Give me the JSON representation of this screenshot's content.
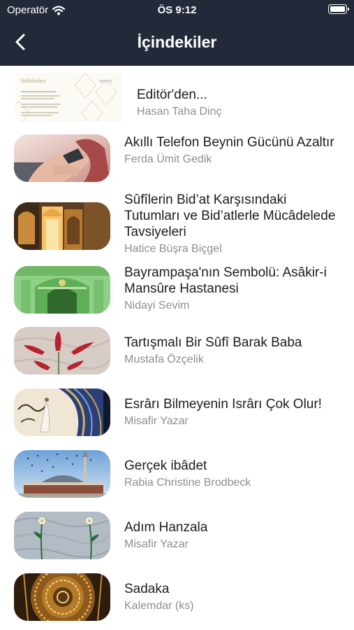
{
  "status": {
    "carrier": "Operatör",
    "time": "ÖS 9:12"
  },
  "nav": {
    "title": "İçindekiler",
    "back_icon": "chevron-left-icon"
  },
  "articles": [
    {
      "title": "Editör'den...",
      "author": "Hasan Taha Dinç",
      "thumbnail": "editorial-page-thumbnail"
    },
    {
      "title": "Akıllı Telefon Beynin Gücünü Azaltır",
      "author": "Ferda Ümit Gedik",
      "thumbnail": "smartphone-hands-thumbnail"
    },
    {
      "title": "Sûfîlerin Bid’at Karşısındaki Tutumları ve Bid’atlerle Mücâdelede Tavsiyeleri",
      "author": "Hatice Büşra Biçgel",
      "thumbnail": "arched-courtyard-thumbnail"
    },
    {
      "title": "Bayrampaşa'nın Sembolü: Asâkir-i Mansûre Hastanesi",
      "author": "Nidayi Sevim",
      "thumbnail": "green-gate-thumbnail"
    },
    {
      "title": "Tartışmalı Bir Sûfî Barak Baba",
      "author": "Mustafa Özçelik",
      "thumbnail": "red-tulip-marbling-thumbnail"
    },
    {
      "title": "Esrârı Bilmeyenin Isrârı Çok Olur!",
      "author": "Misafir Yazar",
      "thumbnail": "calligraphy-dervish-thumbnail"
    },
    {
      "title": "Gerçek ibâdet",
      "author": "Rabia Christine Brodbeck",
      "thumbnail": "mosque-birds-thumbnail"
    },
    {
      "title": "Adım Hanzala",
      "author": "Misafir Yazar",
      "thumbnail": "marbled-flowers-thumbnail"
    },
    {
      "title": "Sadaka",
      "author": "Kalemdar (ks)",
      "thumbnail": "golden-ornament-thumbnail"
    }
  ]
}
